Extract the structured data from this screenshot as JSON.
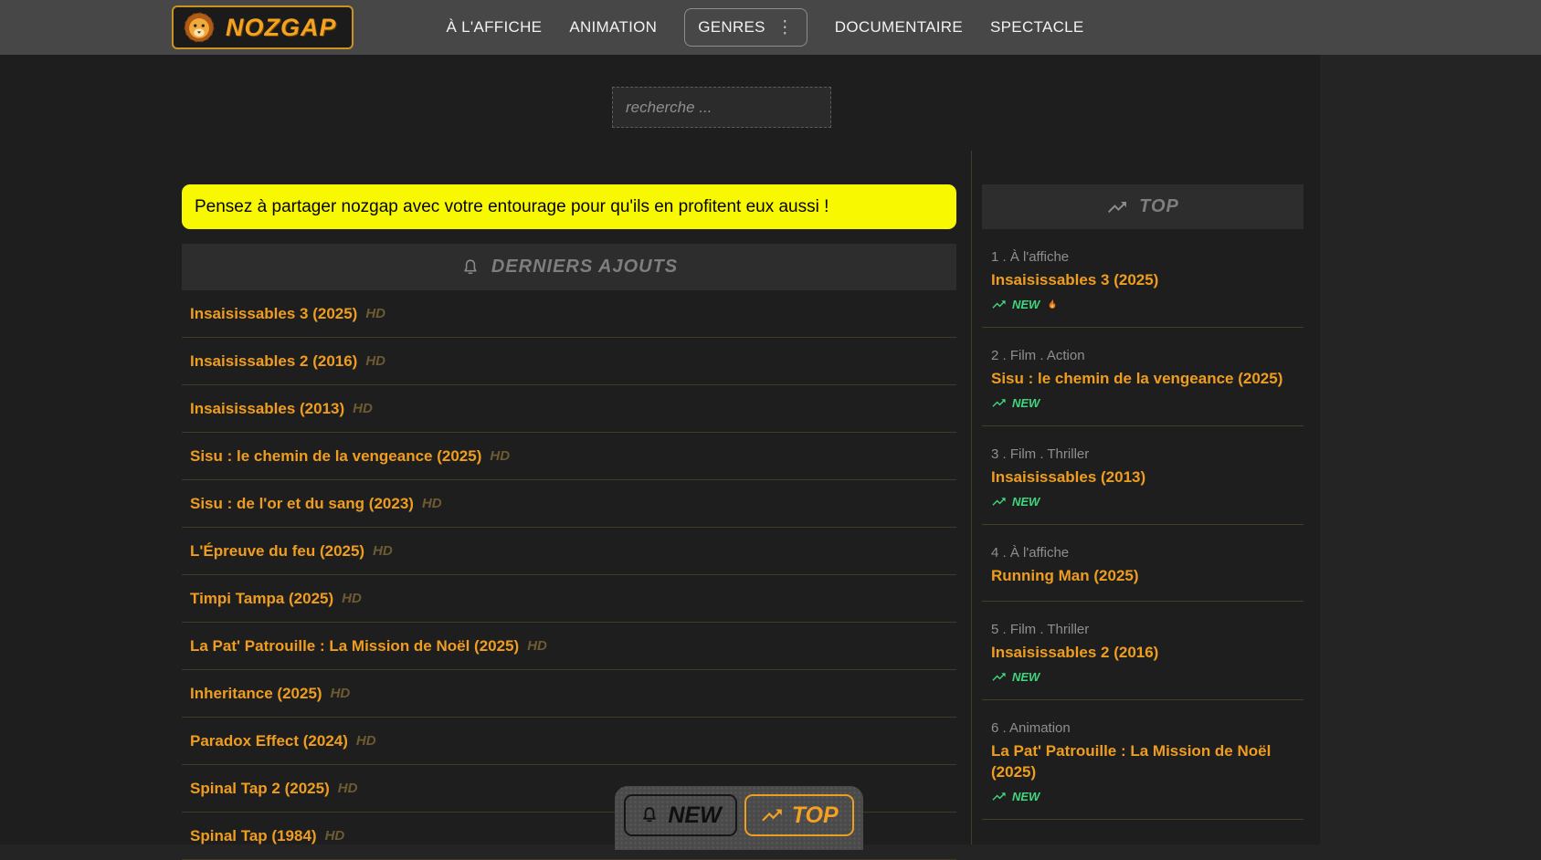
{
  "header": {
    "logo_text": "NOZGAP",
    "nav": {
      "affiche": "À L'AFFICHE",
      "animation": "ANIMATION",
      "genres": "GENRES",
      "documentaire": "DOCUMENTAIRE",
      "spectacle": "SPECTACLE"
    }
  },
  "search": {
    "placeholder": "recherche ..."
  },
  "banner": {
    "text": "Pensez à partager nozgap avec votre entourage pour qu'ils en profitent eux aussi !"
  },
  "latest": {
    "title": "DERNIERS AJOUTS",
    "items": [
      {
        "title": "Insaisissables 3 (2025)",
        "quality": "HD"
      },
      {
        "title": "Insaisissables 2 (2016)",
        "quality": "HD"
      },
      {
        "title": "Insaisissables (2013)",
        "quality": "HD"
      },
      {
        "title": "Sisu : le chemin de la vengeance (2025)",
        "quality": "HD"
      },
      {
        "title": "Sisu : de l'or et du sang (2023)",
        "quality": "HD"
      },
      {
        "title": "L'Épreuve du feu (2025)",
        "quality": "HD"
      },
      {
        "title": "Timpi Tampa (2025)",
        "quality": "HD"
      },
      {
        "title": "La Pat' Patrouille : La Mission de Noël (2025)",
        "quality": "HD"
      },
      {
        "title": "Inheritance (2025)",
        "quality": "HD"
      },
      {
        "title": "Paradox Effect (2024)",
        "quality": "HD"
      },
      {
        "title": "Spinal Tap 2 (2025)",
        "quality": "HD"
      },
      {
        "title": "Spinal Tap (1984)",
        "quality": "HD"
      }
    ]
  },
  "top": {
    "title": "TOP",
    "new_label": "NEW",
    "entries": [
      {
        "rank": "1 . À l'affiche",
        "title": "Insaisissables 3 (2025)",
        "new_badge": true,
        "hot": true
      },
      {
        "rank": "2 . Film . Action",
        "title": "Sisu : le chemin de la vengeance (2025)",
        "new_badge": true,
        "hot": false
      },
      {
        "rank": "3 . Film . Thriller",
        "title": "Insaisissables (2013)",
        "new_badge": true,
        "hot": false
      },
      {
        "rank": "4 . À l'affiche",
        "title": "Running Man (2025)",
        "new_badge": false,
        "hot": false
      },
      {
        "rank": "5 . Film . Thriller",
        "title": "Insaisissables 2 (2016)",
        "new_badge": true,
        "hot": false
      },
      {
        "rank": "6 . Animation",
        "title": "La Pat' Patrouille : La Mission de Noël (2025)",
        "new_badge": true,
        "hot": false
      }
    ]
  },
  "floating_bar": {
    "new_label": "NEW",
    "top_label": "TOP"
  },
  "colors": {
    "accent": "#ee9d20",
    "banner_yellow": "#f8f800",
    "new_green": "#3fd67e",
    "header_gray": "#474747"
  }
}
